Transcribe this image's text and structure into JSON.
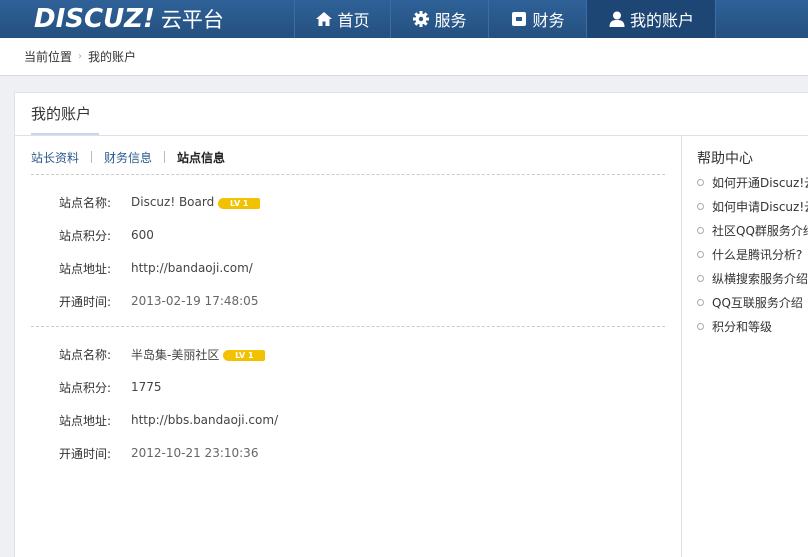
{
  "header": {
    "logo_word": "DISCUZ!",
    "logo_sub": "云平台",
    "nav": [
      {
        "label": "首页",
        "icon": "home-icon"
      },
      {
        "label": "服务",
        "icon": "gear-icon"
      },
      {
        "label": "财务",
        "icon": "finance-icon"
      },
      {
        "label": "我的账户",
        "icon": "user-icon"
      }
    ]
  },
  "breadcrumb": {
    "current_label": "当前位置",
    "separator": "›",
    "page": "我的账户"
  },
  "panel": {
    "title": "我的账户"
  },
  "tabs": [
    {
      "label": "站长资料"
    },
    {
      "label": "财务信息"
    },
    {
      "label": "站点信息"
    }
  ],
  "sites": [
    {
      "name_label": "站点名称:",
      "name": "Discuz! Board",
      "level": "LV 1",
      "score_label": "站点积分:",
      "score": "600",
      "url_label": "站点地址:",
      "url": "http://bandaoji.com/",
      "open_label": "开通时间:",
      "open_time": "2013-02-19 17:48:05"
    },
    {
      "name_label": "站点名称:",
      "name": "半岛集-美丽社区",
      "level": "LV 1",
      "score_label": "站点积分:",
      "score": "1775",
      "url_label": "站点地址:",
      "url": "http://bbs.bandaoji.com/",
      "open_label": "开通时间:",
      "open_time": "2012-10-21 23:10:36"
    }
  ],
  "help": {
    "title": "帮助中心",
    "items": [
      "如何开通Discuz!云",
      "如何申请Discuz!云",
      "社区QQ群服务介绍",
      "什么是腾讯分析?",
      "纵横搜索服务介绍",
      "QQ互联服务介绍",
      "积分和等级"
    ]
  },
  "colors": {
    "header_bg": "#2b5a8e",
    "active_nav": "#1e4675",
    "link": "#2b5a8e",
    "level_badge": "#f2c200"
  }
}
